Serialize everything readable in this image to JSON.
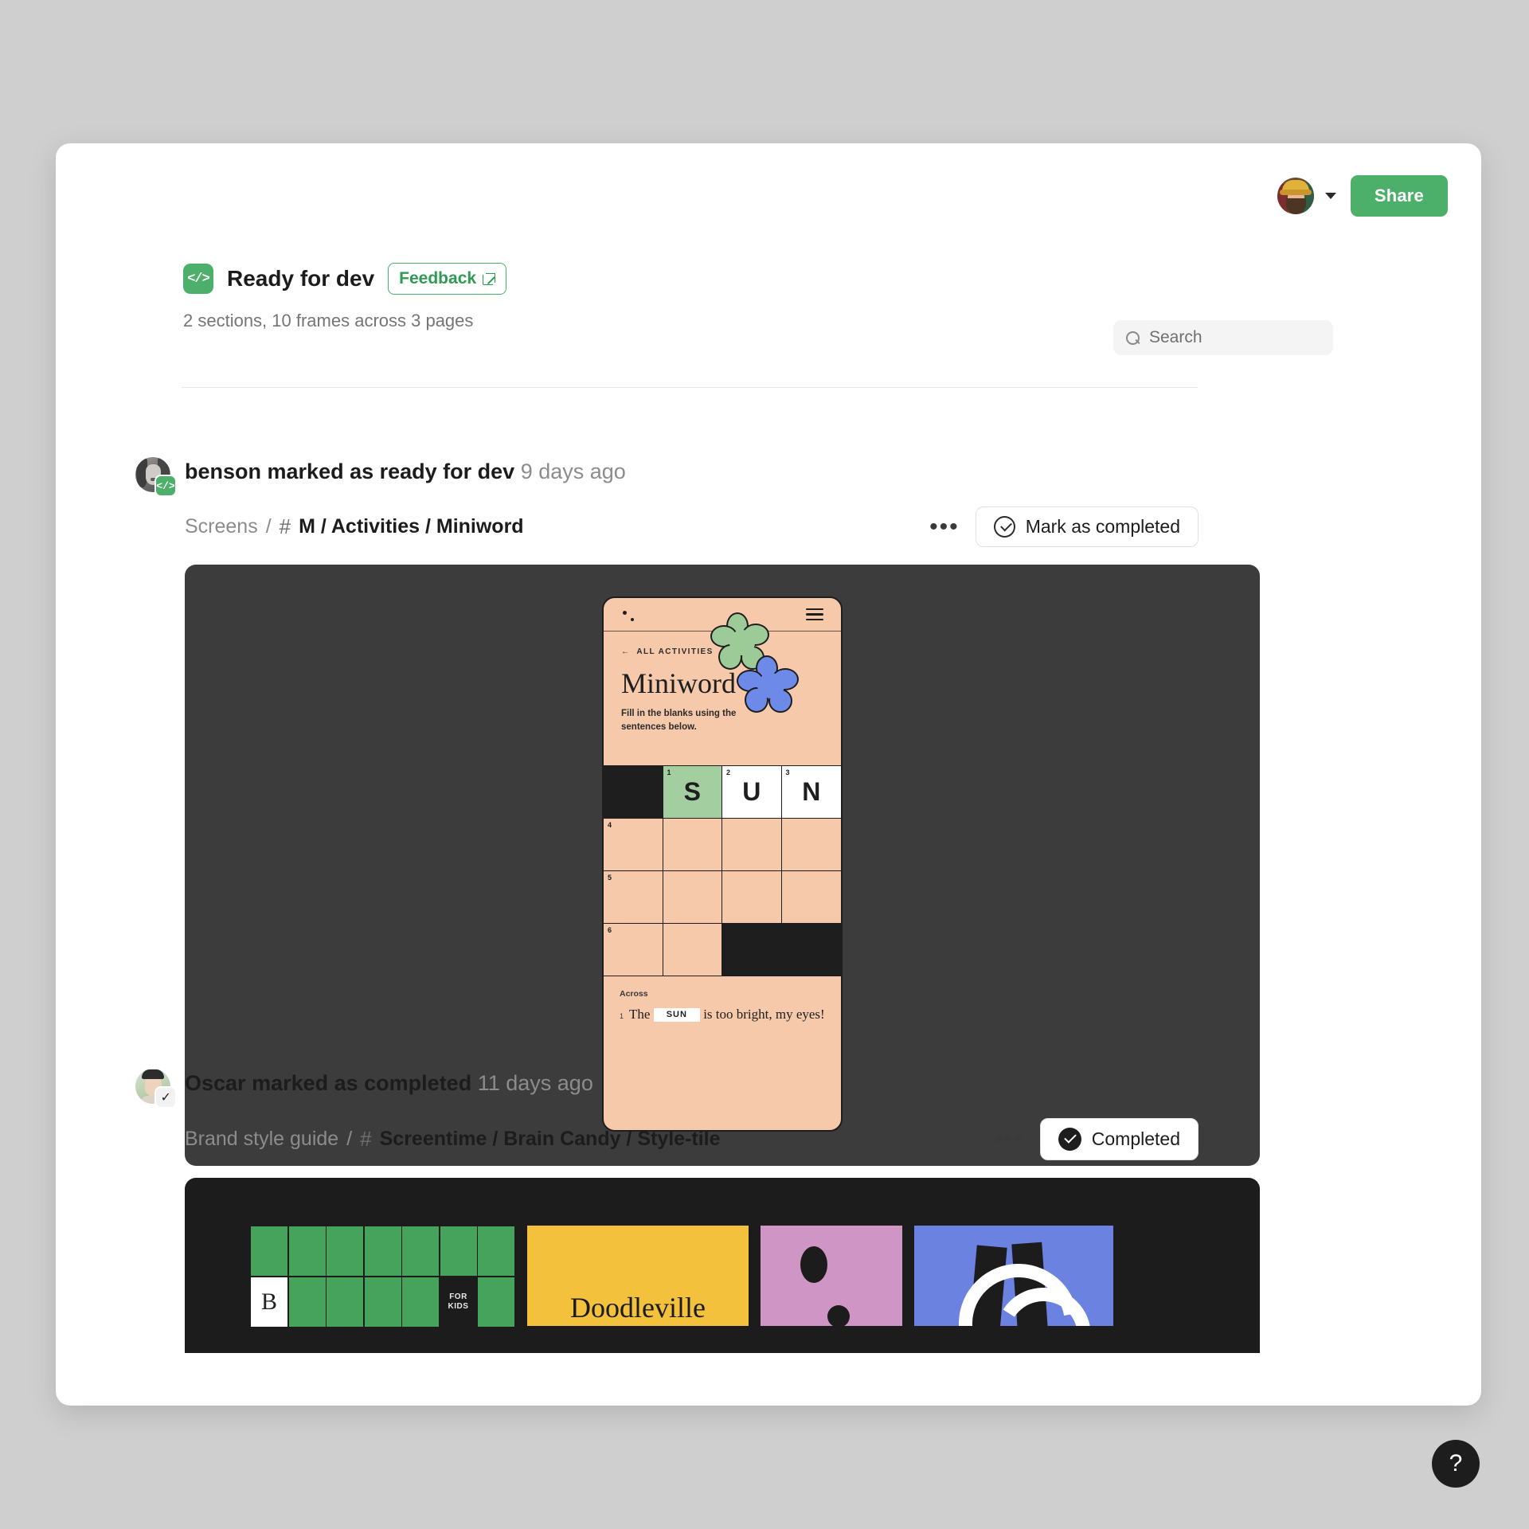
{
  "header": {
    "share_label": "Share",
    "avatar_alt": "user-avatar",
    "chevron": "chevron-down-icon"
  },
  "status": {
    "badge_icon": "</>",
    "title": "Ready for dev",
    "feedback_label": "Feedback",
    "summary": "2 sections, 10 frames across 3 pages"
  },
  "search": {
    "placeholder": "Search",
    "value": "",
    "icon": "search-icon"
  },
  "activities": [
    {
      "actor": "benson",
      "action": "marked as ready for dev",
      "timestamp": "9 days ago",
      "badge": "</>",
      "breadcrumb_root": "Screens",
      "breadcrumb_sep": "/",
      "hash_icon": "#",
      "breadcrumb_path": "M / Activities / Miniword",
      "more_label": "•••",
      "action_button": "Mark as completed",
      "preview": {
        "type": "phone-mockup",
        "back_label": "ALL ACTIVITIES",
        "title": "Miniword",
        "subtitle": "Fill in the blanks using the sentences below.",
        "grid": [
          [
            {
              "state": "black",
              "num": "",
              "letter": ""
            },
            {
              "state": "green",
              "num": "1",
              "letter": "S"
            },
            {
              "state": "white",
              "num": "2",
              "letter": "U"
            },
            {
              "state": "white",
              "num": "3",
              "letter": "N"
            }
          ],
          [
            {
              "state": "empty",
              "num": "4",
              "letter": ""
            },
            {
              "state": "empty",
              "num": "",
              "letter": ""
            },
            {
              "state": "empty",
              "num": "",
              "letter": ""
            },
            {
              "state": "empty",
              "num": "",
              "letter": ""
            }
          ],
          [
            {
              "state": "empty",
              "num": "5",
              "letter": ""
            },
            {
              "state": "empty",
              "num": "",
              "letter": ""
            },
            {
              "state": "empty",
              "num": "",
              "letter": ""
            },
            {
              "state": "empty",
              "num": "",
              "letter": ""
            }
          ],
          [
            {
              "state": "empty",
              "num": "6",
              "letter": ""
            },
            {
              "state": "empty",
              "num": "",
              "letter": ""
            },
            {
              "state": "black",
              "num": "",
              "letter": ""
            },
            {
              "state": "black",
              "num": "",
              "letter": ""
            }
          ]
        ],
        "clues_label": "Across",
        "clue_number": "1",
        "clue_pre": "The",
        "clue_answer": "SUN",
        "clue_post": "is too bright, my eyes!"
      }
    },
    {
      "actor": "Oscar",
      "action": "marked as completed",
      "timestamp": "11 days ago",
      "badge": "check-icon",
      "breadcrumb_root": "Brand style guide",
      "breadcrumb_sep": "/",
      "hash_icon": "#",
      "breadcrumb_path": "Screentime / Brain Candy / Style-tile",
      "more_label": "•••",
      "action_button": "Completed",
      "preview": {
        "type": "style-tile",
        "tile_letter": "B",
        "tile_tag": "FOR KIDS",
        "tile_wordmark": "Doodleville"
      }
    }
  ],
  "help": {
    "label": "?"
  },
  "colors": {
    "accent_green": "#4caf6a",
    "canvas_dark": "#3c3c3c",
    "phone_peach": "#f6c9ab",
    "cell_green": "#a3cfa0",
    "tile_green": "#46a35b",
    "tile_yellow": "#f3c13c",
    "tile_pink": "#cf95c4",
    "tile_blue": "#6b82e0",
    "page_bg": "#cfcfcf"
  }
}
